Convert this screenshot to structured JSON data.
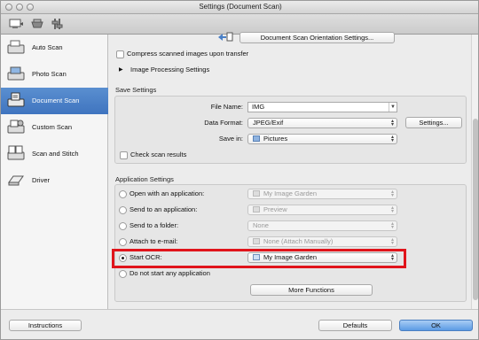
{
  "window": {
    "title": "Settings (Document Scan)"
  },
  "sidebar": {
    "items": [
      {
        "label": "Auto Scan",
        "icon": "auto-scan-icon"
      },
      {
        "label": "Photo Scan",
        "icon": "photo-scan-icon"
      },
      {
        "label": "Document Scan",
        "icon": "document-scan-icon",
        "selected": true
      },
      {
        "label": "Custom Scan",
        "icon": "custom-scan-icon"
      },
      {
        "label": "Scan and Stitch",
        "icon": "scan-and-stitch-icon"
      },
      {
        "label": "Driver",
        "icon": "driver-icon"
      }
    ]
  },
  "scan_options": {
    "orientation_button": "Document Scan Orientation Settings...",
    "compress_label": "Compress scanned images upon transfer",
    "image_processing_label": "Image Processing Settings"
  },
  "save_settings": {
    "title": "Save Settings",
    "file_name_label": "File Name:",
    "file_name_value": "IMG",
    "data_format_label": "Data Format:",
    "data_format_value": "JPEG/Exif",
    "settings_button": "Settings...",
    "save_in_label": "Save in:",
    "save_in_value": "Pictures",
    "check_results_label": "Check scan results"
  },
  "application_settings": {
    "title": "Application Settings",
    "rows": [
      {
        "label": "Open with an application:",
        "value": "My Image Garden",
        "selected": false,
        "enabled": false
      },
      {
        "label": "Send to an application:",
        "value": "Preview",
        "selected": false,
        "enabled": false
      },
      {
        "label": "Send to a folder:",
        "value": "None",
        "selected": false,
        "enabled": false
      },
      {
        "label": "Attach to e-mail:",
        "value": "None (Attach Manually)",
        "selected": false,
        "enabled": false
      },
      {
        "label": "Start OCR:",
        "value": "My Image Garden",
        "selected": true,
        "enabled": true
      },
      {
        "label": "Do not start any application",
        "selected": false
      }
    ],
    "more_functions_button": "More Functions"
  },
  "footer": {
    "instructions_button": "Instructions",
    "defaults_button": "Defaults",
    "ok_button": "OK"
  },
  "colors": {
    "selection": "#4a80c7",
    "highlight": "#e0141b",
    "ok_button": "#5b9be4"
  }
}
